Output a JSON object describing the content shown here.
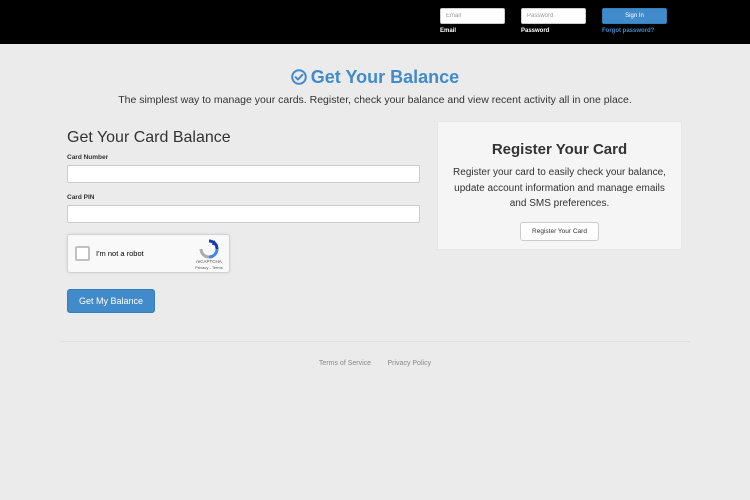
{
  "header": {
    "email": {
      "placeholder": "Email",
      "label": "Email"
    },
    "password": {
      "placeholder": "Password",
      "label": "Password"
    },
    "signin_label": "Sign In",
    "forgot_label": "Forgot password?"
  },
  "hero": {
    "title": "Get Your Balance",
    "title_icon": "check-circle-icon",
    "subtitle": "The simplest way to manage your cards. Register, check your balance and view recent activity all in one place."
  },
  "balance_form": {
    "heading": "Get Your Card Balance",
    "card_number_label": "Card Number",
    "card_pin_label": "Card PIN",
    "card_number_value": "",
    "card_pin_value": "",
    "captcha": {
      "label": "I'm not a robot",
      "brand": "reCAPTCHA",
      "terms": "Privacy - Terms",
      "logo_icon": "recaptcha-logo-icon"
    },
    "submit_label": "Get My Balance"
  },
  "register": {
    "title": "Register Your Card",
    "text": "Register your card to easily check your balance, update account information and manage emails and SMS preferences.",
    "button_label": "Register Your Card"
  },
  "footer": {
    "links": [
      "Terms of Service",
      "Privacy Policy"
    ]
  },
  "colors": {
    "accent": "#428bca",
    "background": "#ebebeb",
    "topbar": "#000000"
  }
}
